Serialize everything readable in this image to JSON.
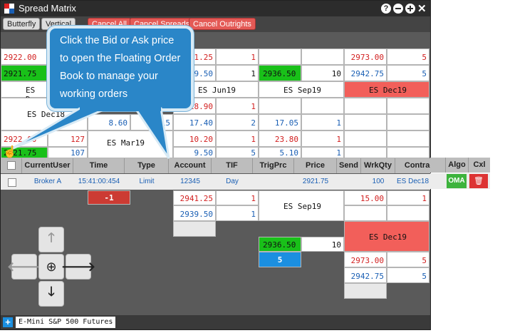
{
  "window": {
    "title": "Spread Matrix",
    "controls": [
      "help-icon",
      "minimize-icon",
      "maximize-icon",
      "close-icon"
    ]
  },
  "toolbar": {
    "butterfly": "Butterfly",
    "vertical": "Vertical",
    "cancel_all": "Cancel All",
    "cancel_spreads": "Cancel Spreads",
    "cancel_outrights": "Cancel Outrights"
  },
  "callout": {
    "text": "Click the Bid or Ask price to open the Floating Order Book to manage your working orders"
  },
  "grid": {
    "r1": {
      "c1": "2922.00",
      "c4": "1.25",
      "c4q": "1",
      "c7": "2973.00",
      "c7q": "5"
    },
    "r2": {
      "c1": "2921.75",
      "c4": "9.50",
      "c4q": "1",
      "c5": "2936.50",
      "c5q": "10",
      "c7": "2942.75",
      "c7q": "5"
    },
    "r3": {
      "c1": "ES Dec",
      "c4": "ES Jun19",
      "c5": "ES Sep19",
      "c7": "ES Dec19"
    },
    "r4": {
      "c4": "18.90",
      "c4q": "1"
    },
    "r4b": {
      "c1": "ES Dec18"
    },
    "r5": {
      "c3": "8.60",
      "c3q": "615",
      "c4": "17.40",
      "c4q": "2",
      "c5": "17.05",
      "c5q": "1"
    },
    "r6": {
      "c1": "2922.00",
      "c1q": "127",
      "c4": "10.20",
      "c4q": "1",
      "c5": "23.80",
      "c5q": "1"
    },
    "r6b": {
      "c3": "ES Mar19"
    },
    "r7": {
      "c1": "2921.75",
      "c1q": "107",
      "c4": "9.50",
      "c4q": "5",
      "c5": "5.10",
      "c5q": "1"
    },
    "lower": {
      "neg": "-1",
      "p1": "2941.25",
      "p1q": "1",
      "p2": "2939.50",
      "p2q": "1",
      "sep": "ES Sep19",
      "q15": "15.00",
      "q15q": "1",
      "dec19": "ES Dec19",
      "bid": "2936.50",
      "bidq": "10",
      "five": "5",
      "a1": "2973.00",
      "a1q": "5",
      "a2": "2942.75",
      "a2q": "5"
    }
  },
  "orders": {
    "headers": [
      "CurrentUser",
      "Time",
      "Type",
      "Account",
      "TIF",
      "TrigPrc",
      "Price",
      "Send",
      "WrkQty",
      "Contract",
      "Algo",
      "Cxl"
    ],
    "row": {
      "user": "Broker A",
      "time": "15:41:00:454",
      "type": "Limit",
      "account": "12345",
      "tif": "Day",
      "trigprc": "",
      "price": "2921.75",
      "send": "",
      "wrkqty": "100",
      "contract": "ES Dec18",
      "algo": "OMA"
    }
  },
  "footer": {
    "add": "+",
    "instrument": "E-Mini S&P 500 Futures"
  },
  "colors": {
    "bid_green": "#19c019",
    "ask_red": "#f25f5a",
    "callout_blue": "#2a86c8"
  }
}
